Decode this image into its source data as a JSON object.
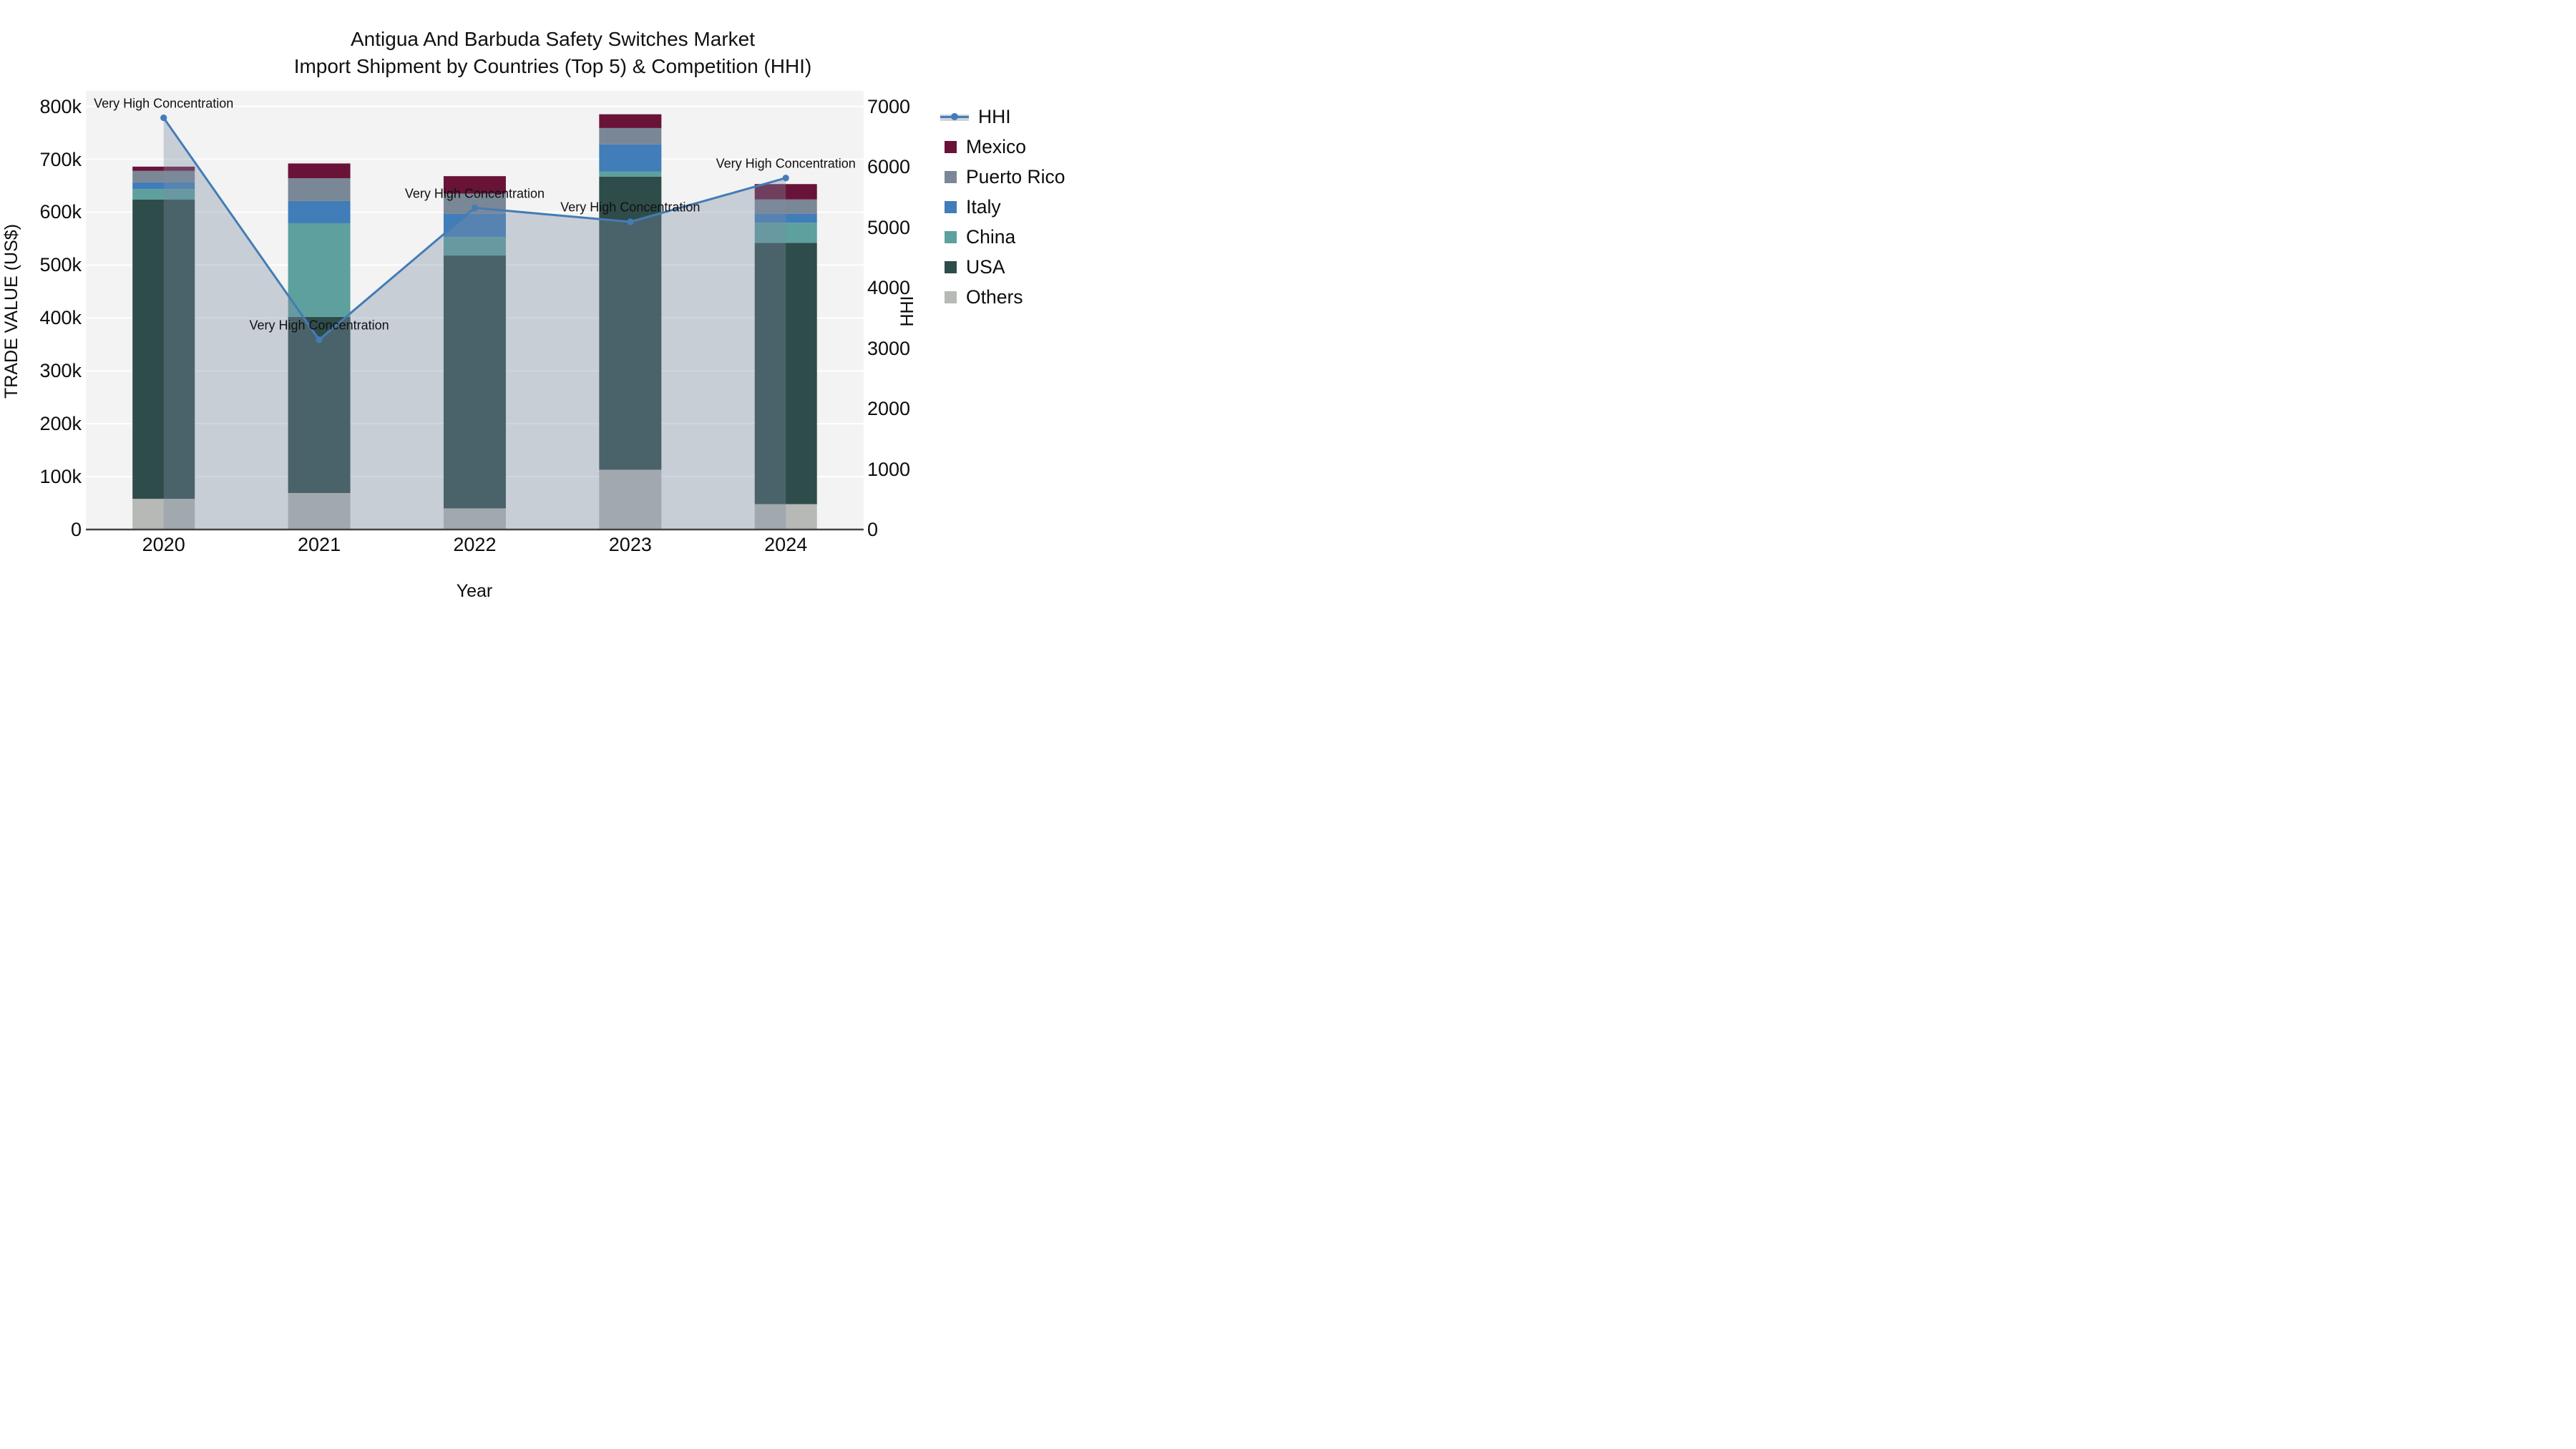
{
  "title": {
    "line1": "Antigua And Barbuda Safety Switches Market",
    "line2": "Import Shipment by Countries (Top 5) & Competition (HHI)"
  },
  "axes": {
    "y_left": {
      "title": "TRADE VALUE (US$)",
      "tick_labels": [
        "0",
        "100k",
        "200k",
        "300k",
        "400k",
        "500k",
        "600k",
        "700k",
        "800k"
      ],
      "range": [
        0,
        800000
      ]
    },
    "y_right": {
      "title": "HHI",
      "tick_labels": [
        "0",
        "1000",
        "2000",
        "3000",
        "4000",
        "5000",
        "6000",
        "7000"
      ],
      "range": [
        0,
        7000
      ]
    },
    "x": {
      "title": "Year",
      "tick_labels": [
        "2020",
        "2021",
        "2022",
        "2023",
        "2024"
      ]
    }
  },
  "legend": {
    "items": [
      {
        "label": "HHI",
        "type": "line",
        "color": "#447CB6"
      },
      {
        "label": "Mexico",
        "type": "swatch",
        "color": "#691338"
      },
      {
        "label": "Puerto Rico",
        "type": "swatch",
        "color": "#7A8796"
      },
      {
        "label": "Italy",
        "type": "swatch",
        "color": "#407DB9"
      },
      {
        "label": "China",
        "type": "swatch",
        "color": "#5DA09E"
      },
      {
        "label": "USA",
        "type": "swatch",
        "color": "#2E4C4A"
      },
      {
        "label": "Others",
        "type": "swatch",
        "color": "#B6B9B6"
      }
    ]
  },
  "chart_data": {
    "type": "bar",
    "stacked": true,
    "title": "Antigua And Barbuda Safety Switches Market — Import Shipment by Countries (Top 5) & Competition (HHI)",
    "categories": [
      "2020",
      "2021",
      "2022",
      "2023",
      "2024"
    ],
    "series": [
      {
        "name": "Others",
        "color": "#B6B9B6",
        "values": [
          58000,
          69000,
          40000,
          113000,
          48000
        ]
      },
      {
        "name": "USA",
        "color": "#2E4C4A",
        "values": [
          566000,
          333000,
          478000,
          554000,
          494000
        ]
      },
      {
        "name": "China",
        "color": "#5DA09E",
        "values": [
          19500,
          177000,
          35000,
          10000,
          38000
        ]
      },
      {
        "name": "Italy",
        "color": "#407DB9",
        "values": [
          13000,
          42000,
          44000,
          51000,
          17000
        ]
      },
      {
        "name": "Puerto Rico",
        "color": "#7A8796",
        "values": [
          21500,
          43000,
          38000,
          31000,
          27000
        ]
      },
      {
        "name": "Mexico",
        "color": "#691338",
        "values": [
          8000,
          28000,
          33000,
          26000,
          29000
        ]
      }
    ],
    "line_series": {
      "name": "HHI",
      "axis": "right",
      "color": "#447CB6",
      "fill_color": "rgba(125,140,164,0.36)",
      "marker": "circle",
      "values": [
        6810,
        3140,
        5320,
        5090,
        5815
      ],
      "point_annotations": [
        "Very High Concentration",
        "Very High Concentration",
        "Very High Concentration",
        "Very High Concentration",
        "Very High Concentration"
      ]
    },
    "xlabel": "Year",
    "ylabel": "TRADE VALUE (US$)",
    "ylabel_right": "HHI",
    "ylim_left": [
      0,
      800000
    ],
    "ylim_right": [
      0,
      7000
    ],
    "grid": true,
    "legend_position": "right",
    "panel_color": "#F2F3F2",
    "grid_color": "#FFFFFF",
    "axis_line_color": "#444444"
  }
}
